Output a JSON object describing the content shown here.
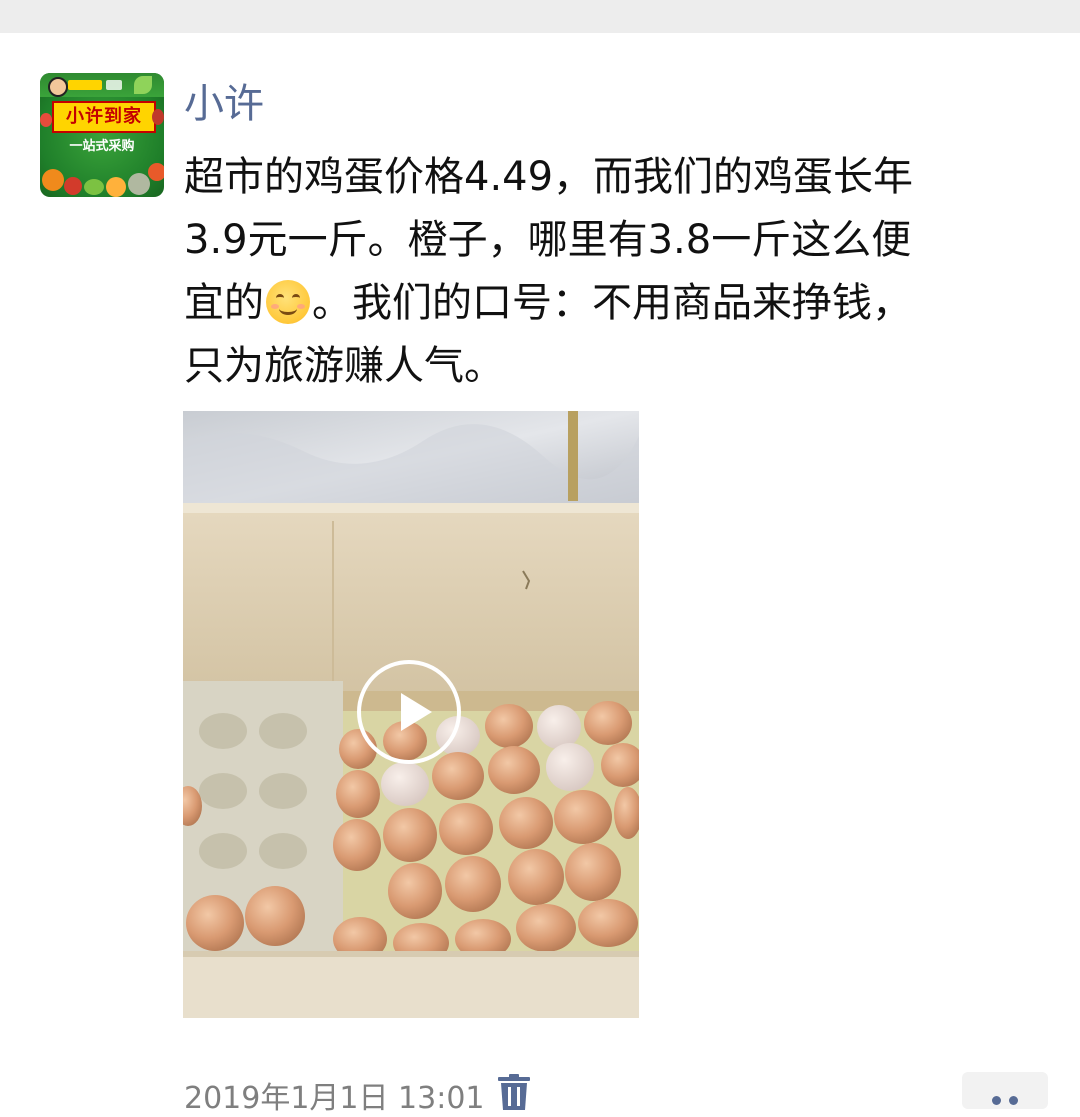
{
  "post": {
    "author": "小许",
    "text_part1": "超市的鸡蛋价格4.49，而我们的鸡蛋长年\n3.9元一斤。橙子，哪里有3.8一斤这么便\n宜的",
    "emoji": "smiling-face-icon",
    "text_part2": "。我们的口号：不用商品来挣钱，\n只为旅游赚人气。",
    "timestamp": "2019年1月1日 13:01"
  },
  "avatar": {
    "title": "小许到家",
    "subtitle": "一站式采购"
  },
  "media": {
    "type": "video",
    "play_icon": "play-icon"
  },
  "actions": {
    "delete_icon": "trash-icon",
    "more_icon": "more-dots-icon"
  },
  "colors": {
    "name_link": "#576b95",
    "timestamp": "#7f7f7f",
    "topbar": "#ededed"
  }
}
